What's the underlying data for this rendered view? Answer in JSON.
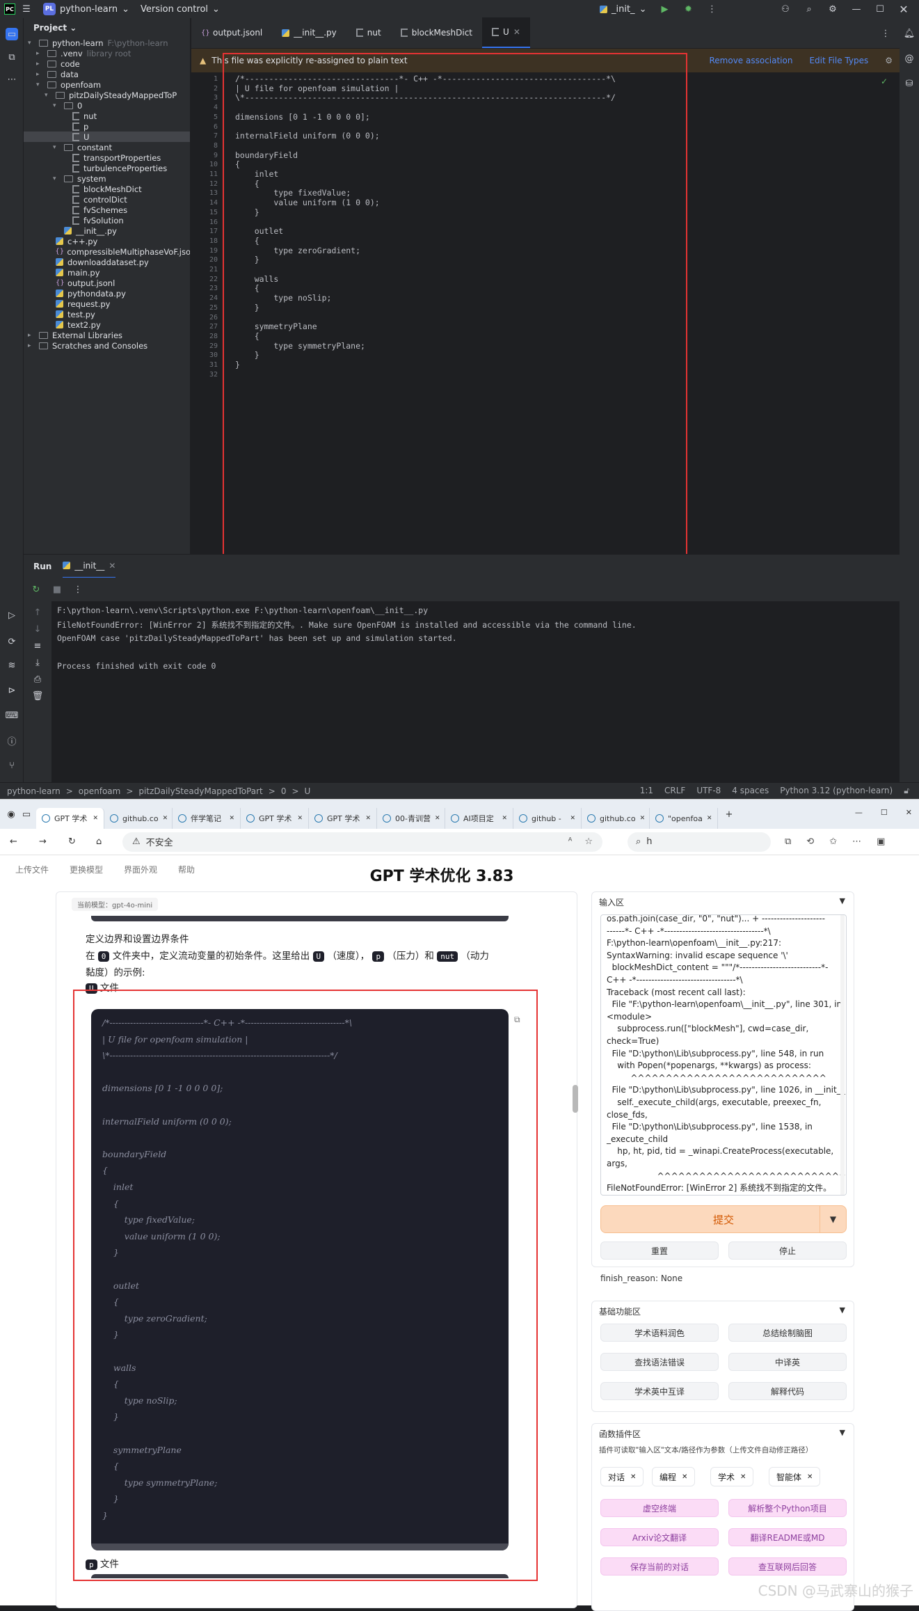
{
  "ide": {
    "titlebar": {
      "project_badge": "PL",
      "project_name": "python-learn",
      "vcs": "Version control",
      "run_config": "_init_"
    },
    "project_panel": {
      "title": "Project",
      "tree": [
        {
          "label": "python-learn",
          "hint": "F:\\python-learn",
          "depth": 0,
          "kind": "folder",
          "open": true
        },
        {
          "label": ".venv",
          "hint": "library root",
          "depth": 1,
          "kind": "folder",
          "open": false
        },
        {
          "label": "code",
          "hint": "",
          "depth": 1,
          "kind": "folder",
          "open": false
        },
        {
          "label": "data",
          "hint": "",
          "depth": 1,
          "kind": "folder",
          "open": false
        },
        {
          "label": "openfoam",
          "hint": "",
          "depth": 1,
          "kind": "folder",
          "open": true
        },
        {
          "label": "pitzDailySteadyMappedToP",
          "hint": "",
          "depth": 2,
          "kind": "folder",
          "open": true
        },
        {
          "label": "0",
          "hint": "",
          "depth": 3,
          "kind": "folder",
          "open": true
        },
        {
          "label": "nut",
          "hint": "",
          "depth": 4,
          "kind": "file"
        },
        {
          "label": "p",
          "hint": "",
          "depth": 4,
          "kind": "file"
        },
        {
          "label": "U",
          "hint": "",
          "depth": 4,
          "kind": "file",
          "selected": true
        },
        {
          "label": "constant",
          "hint": "",
          "depth": 3,
          "kind": "folder",
          "open": true
        },
        {
          "label": "transportProperties",
          "hint": "",
          "depth": 4,
          "kind": "file"
        },
        {
          "label": "turbulenceProperties",
          "hint": "",
          "depth": 4,
          "kind": "file"
        },
        {
          "label": "system",
          "hint": "",
          "depth": 3,
          "kind": "folder",
          "open": true
        },
        {
          "label": "blockMeshDict",
          "hint": "",
          "depth": 4,
          "kind": "file"
        },
        {
          "label": "controlDict",
          "hint": "",
          "depth": 4,
          "kind": "file"
        },
        {
          "label": "fvSchemes",
          "hint": "",
          "depth": 4,
          "kind": "file"
        },
        {
          "label": "fvSolution",
          "hint": "",
          "depth": 4,
          "kind": "file"
        },
        {
          "label": "__init__.py",
          "hint": "",
          "depth": 3,
          "kind": "py"
        },
        {
          "label": "c++.py",
          "hint": "",
          "depth": 2,
          "kind": "py"
        },
        {
          "label": "compressibleMultiphaseVoF.jso",
          "hint": "",
          "depth": 2,
          "kind": "json"
        },
        {
          "label": "downloaddataset.py",
          "hint": "",
          "depth": 2,
          "kind": "py"
        },
        {
          "label": "main.py",
          "hint": "",
          "depth": 2,
          "kind": "py"
        },
        {
          "label": "output.jsonl",
          "hint": "",
          "depth": 2,
          "kind": "json"
        },
        {
          "label": "pythondata.py",
          "hint": "",
          "depth": 2,
          "kind": "py"
        },
        {
          "label": "request.py",
          "hint": "",
          "depth": 2,
          "kind": "py"
        },
        {
          "label": "test.py",
          "hint": "",
          "depth": 2,
          "kind": "py"
        },
        {
          "label": "text2.py",
          "hint": "",
          "depth": 2,
          "kind": "py"
        },
        {
          "label": "External Libraries",
          "hint": "",
          "depth": 0,
          "kind": "lib",
          "open": false
        },
        {
          "label": "Scratches and Consoles",
          "hint": "",
          "depth": 0,
          "kind": "scratch",
          "open": false
        }
      ]
    },
    "editor_tabs": [
      {
        "label": "output.jsonl",
        "kind": "json"
      },
      {
        "label": "__init__.py",
        "kind": "py"
      },
      {
        "label": "nut",
        "kind": "file"
      },
      {
        "label": "blockMeshDict",
        "kind": "file"
      },
      {
        "label": "U",
        "kind": "file",
        "active": true
      }
    ],
    "banner": {
      "message": "This file was explicitly re-assigned to plain text",
      "remove": "Remove association",
      "edit": "Edit File Types"
    },
    "code_lines": [
      "/*--------------------------------*- C++ -*----------------------------------*\\",
      "| U file for openfoam simulation |",
      "\\*---------------------------------------------------------------------------*/",
      "",
      "dimensions [0 1 -1 0 0 0 0];",
      "",
      "internalField uniform (0 0 0);",
      "",
      "boundaryField",
      "{",
      "    inlet",
      "    {",
      "        type fixedValue;",
      "        value uniform (1 0 0);",
      "    }",
      "",
      "    outlet",
      "    {",
      "        type zeroGradient;",
      "    }",
      "",
      "    walls",
      "    {",
      "        type noSlip;",
      "    }",
      "",
      "    symmetryPlane",
      "    {",
      "        type symmetryPlane;",
      "    }",
      "}",
      ""
    ],
    "run_panel": {
      "tab_run": "Run",
      "tab_config": "__init__",
      "console_lines": [
        "F:\\python-learn\\.venv\\Scripts\\python.exe F:\\python-learn\\openfoam\\__init__.py",
        "FileNotFoundError: [WinError 2] 系统找不到指定的文件。. Make sure OpenFOAM is installed and accessible via the command line.",
        "OpenFOAM case 'pitzDailySteadyMappedToPart' has been set up and simulation started.",
        "",
        "Process finished with exit code 0"
      ]
    },
    "statusbar": {
      "breadcrumb": [
        "python-learn",
        "openfoam",
        "pitzDailySteadyMappedToPart",
        "0",
        "U"
      ],
      "position": "1:1",
      "line_sep": "CRLF",
      "encoding": "UTF-8",
      "indent": "4 spaces",
      "interpreter": "Python 3.12 (python-learn)"
    }
  },
  "browser": {
    "tabs": [
      {
        "label": "GPT 学术",
        "active": true
      },
      {
        "label": "github.co"
      },
      {
        "label": "伴学笔记"
      },
      {
        "label": "GPT 学术"
      },
      {
        "label": "GPT 学术"
      },
      {
        "label": "00-青训营"
      },
      {
        "label": "AI项目定"
      },
      {
        "label": "github -"
      },
      {
        "label": "github.co"
      },
      {
        "label": "\"openfoa"
      }
    ],
    "address": {
      "security": "不安全",
      "url": "",
      "search": "h"
    },
    "page": {
      "menu": [
        "上传文件",
        "更换模型",
        "界面外观",
        "帮助"
      ],
      "title": "GPT 学术优化 3.83",
      "model": "当前模型：gpt-4o-mini",
      "chat_heading": "定义边界和设置边界条件",
      "chat_line1_a": "在",
      "chat_line1_tag0": "0",
      "chat_line1_b": "文件夹中，定义流动变量的初始条件。这里给出",
      "chat_tag_u": "U",
      "chat_line1_c": "（速度），",
      "chat_tag_p": "p",
      "chat_line1_d": "（压力）和",
      "chat_tag_nut": "nut",
      "chat_line1_e": "（动力",
      "chat_line2": "黏度）的示例:",
      "chat_file_u_tag": "U",
      "chat_file_label": "文件",
      "chat_file_p_tag": "p",
      "code_lines": [
        "/*--------------------------------*- C++ -*----------------------------------*\\",
        "| U file for openfoam simulation |",
        "\\*---------------------------------------------------------------------------*/",
        "",
        "dimensions [0 1 -1 0 0 0 0];",
        "",
        "internalField uniform (0 0 0);",
        "",
        "boundaryField",
        "{",
        "    inlet",
        "    {",
        "        type fixedValue;",
        "        value uniform (1 0 0);",
        "    }",
        "",
        "    outlet",
        "    {",
        "        type zeroGradient;",
        "    }",
        "",
        "    walls",
        "    {",
        "        type noSlip;",
        "    }",
        "",
        "    symmetryPlane",
        "    {",
        "        type symmetryPlane;",
        "    }",
        "}"
      ],
      "input_panel": {
        "title": "输入区",
        "text_lines": [
          "os.path.join(case_dir, \"0\", \"nut\")... + ---------------------",
          "------*- C++ -*---------------------------------*\\",
          "F:\\python-learn\\openfoam\\__init__.py:217:",
          "SyntaxWarning: invalid escape sequence '\\'",
          "  blockMeshDict_content = \"\"\"/*---------------------------*-",
          "C++ -*---------------------------------*\\",
          "Traceback (most recent call last):",
          "  File \"F:\\python-learn\\openfoam\\__init__.py\", line 301, in",
          "<module>",
          "    subprocess.run([\"blockMesh\"], cwd=case_dir,",
          "check=True)",
          "  File \"D:\\python\\Lib\\subprocess.py\", line 548, in run",
          "    with Popen(*popenargs, **kwargs) as process:",
          "         ^^^^^^^^^^^^^^^^^^^^^^^^^^^^",
          "  File \"D:\\python\\Lib\\subprocess.py\", line 1026, in __init__",
          "    self._execute_child(args, executable, preexec_fn,",
          "close_fds,",
          "  File \"D:\\python\\Lib\\subprocess.py\", line 1538, in",
          "_execute_child",
          "    hp, ht, pid, tid = _winapi.CreateProcess(executable,",
          "args,",
          "                   ^^^^^^^^^^^^^^^^^^^^^^^^^^^^^^^^^^^^",
          "FileNotFoundError: [WinError 2] 系统找不到指定的文件。"
        ],
        "submit": "提交",
        "reset": "重置",
        "stop": "停止",
        "finish_reason": "finish_reason: None"
      },
      "basic_panel": {
        "title": "基础功能区",
        "buttons": [
          "学术语料润色",
          "总结绘制脑图",
          "查找语法错误",
          "中译英",
          "学术英中互译",
          "解释代码"
        ]
      },
      "plugin_panel": {
        "title": "函数插件区",
        "hint": "插件可读取\"输入区\"文本/路径作为参数（上传文件自动修正路径）",
        "chips": [
          "对话",
          "编程",
          "学术",
          "智能体"
        ],
        "buttons": [
          "虚空终端",
          "解析整个Python项目",
          "Arxiv论文翻译",
          "翻译README或MD",
          "保存当前的对话",
          "查互联网后回答"
        ]
      },
      "watermark": "CSDN @马武寨山的猴子"
    }
  },
  "colors": {
    "ide_bg": "#1e1f22",
    "ide_panel": "#2b2d30",
    "annotation_red": "#e53333",
    "accent_blue": "#3574f0",
    "submit_orange": "#d25700",
    "plugin_pink": "#fbdcf6"
  }
}
